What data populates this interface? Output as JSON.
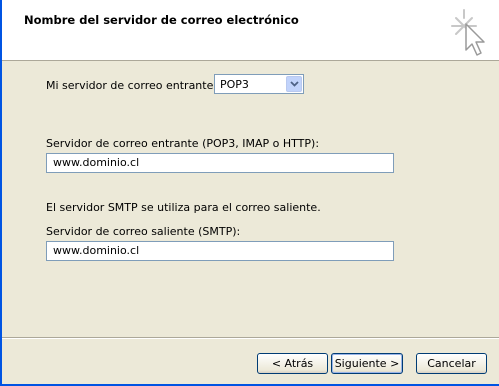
{
  "header": {
    "title": "Nombre del servidor de correo electrónico",
    "icon": "wizard-cursor-icon"
  },
  "incoming_type": {
    "label": "Mi servidor de correo entrante es",
    "value": "POP3"
  },
  "incoming_server": {
    "label": "Servidor de correo entrante (POP3, IMAP o HTTP):",
    "value": "www.dominio.cl"
  },
  "smtp_note": "El servidor SMTP se utiliza para el correo saliente.",
  "outgoing_server": {
    "label": "Servidor de correo saliente (SMTP):",
    "value": "www.dominio.cl"
  },
  "buttons": {
    "back": "< Atrás",
    "next": "Siguiente >",
    "cancel": "Cancelar"
  },
  "colors": {
    "window_bg": "#ece9d8",
    "header_bg": "#ffffff",
    "frame_blue": "#0054e3",
    "input_border": "#7f9db9",
    "button_border": "#003c74"
  }
}
